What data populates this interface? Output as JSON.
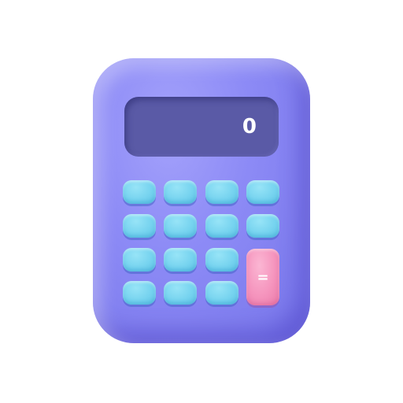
{
  "calculator": {
    "display": {
      "value": "0"
    },
    "keypad": {
      "equals_label": "="
    }
  },
  "colors": {
    "body": "#8d8bf6",
    "display": "#5a5aa6",
    "key": "#76d3ef",
    "equals_key": "#f594bd"
  }
}
